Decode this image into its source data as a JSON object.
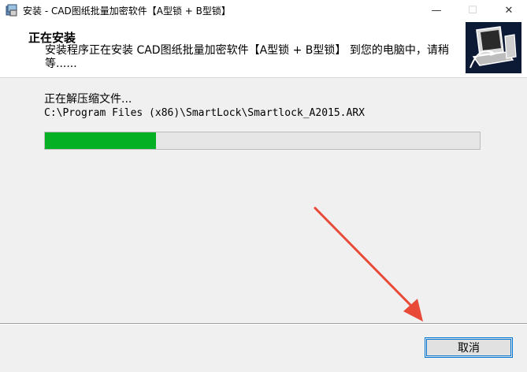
{
  "window": {
    "title": "安装 - CAD图纸批量加密软件【A型锁 + B型锁】",
    "minimize_glyph": "—",
    "maximize_glyph": "☐",
    "close_glyph": "✕"
  },
  "header": {
    "title": "正在安装",
    "subtitle": "安装程序正在安装 CAD图纸批量加密软件【A型锁 + B型锁】 到您的电脑中，请稍等......"
  },
  "body": {
    "status_label": "正在解压缩文件...",
    "file_path": "C:\\Program Files (x86)\\SmartLock\\Smartlock_A2015.ARX",
    "progress_fraction": 0.255
  },
  "footer": {
    "cancel_label": "取消"
  },
  "colors": {
    "progress": "#06b025",
    "accent": "#0078d7",
    "annotation_arrow": "#e84a37"
  },
  "icons": [
    "installer-app-icon",
    "computer-install-logo-icon"
  ]
}
